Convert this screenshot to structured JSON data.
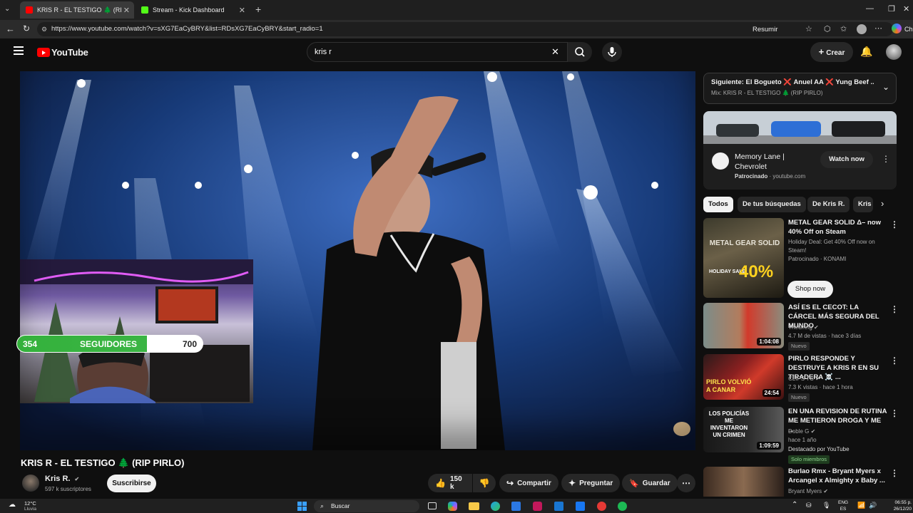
{
  "browser": {
    "tabs": [
      {
        "label": "KRIS R - EL TESTIGO 🌲 (RIP PIRLO",
        "favicon_color": "#ff0000"
      },
      {
        "label": "Stream - Kick Dashboard",
        "favicon_color": "#53fc18"
      }
    ],
    "url": "https://www.youtube.com/watch?v=sXG7EaCyBRY&list=RDsXG7EaCyBRY&start_radio=1",
    "resumir_label": "Resumir",
    "profile_partial": "Ch"
  },
  "youtube": {
    "logo_text": "YouTube",
    "search_value": "kris r",
    "create_label": "Crear"
  },
  "stream_overlay": {
    "followers_current": "354",
    "followers_label": "SEGUIDORES",
    "followers_goal": "700"
  },
  "video": {
    "title": "KRIS R - EL TESTIGO 🌲 (RIP PIRLO)",
    "channel": "Kris R.",
    "subscribers": "597 k suscriptores",
    "subscribe_label": "Suscribirse",
    "likes": "150 k",
    "share_label": "Compartir",
    "ask_label": "Preguntar",
    "save_label": "Guardar"
  },
  "up_next": {
    "title": "Siguiente: El Bogueto ❌ Anuel AA ❌ Yung Beef ...",
    "subtitle": "Mix: KRIS R - EL TESTIGO 🌲 (RIP PIRLO)"
  },
  "ad": {
    "title_line1": "Memory Lane |",
    "title_line2": "Chevrolet",
    "sponsored": "Patrocinado",
    "domain": "· youtube.com",
    "cta": "Watch now"
  },
  "chips": [
    "Todos",
    "De tus búsquedas",
    "De Kris R.",
    "Kris"
  ],
  "recommendations": [
    {
      "title": "METAL GEAR SOLID Δ– now 40% Off on Steam",
      "line1": "Holiday Deal: Get 40% Off now on Steam!",
      "line2": "Patrocinado · KONAMI",
      "cta": "Shop now",
      "thumb_text": "METAL GEAR SOLID",
      "thumb_sale": "40%",
      "thumb_sale_label": "HOLIDAY SALE"
    },
    {
      "title": "ASÍ ES EL CECOT: LA CÁRCEL MÁS SEGURA DEL MUNDO",
      "channel": "TheGrefg",
      "stats": "4.7 M de vistas · hace 3 días",
      "badge": "Nuevo",
      "duration": "1:04:08"
    },
    {
      "title": "PIRLO RESPONDE Y DESTRUYE A KRIS R EN SU TIRADERA ☠️ ...",
      "channel": "CLIPS TC",
      "stats": "7.3 K vistas · hace 1 hora",
      "badge": "Nuevo",
      "duration": "24:54",
      "thumb_text": "PIRLO VOLVIÓ A CANAR"
    },
    {
      "title": "EN UNA REVISION DE RUTINA ME METIERON DROGA Y ME ...",
      "channel": "Doble G",
      "stats": "hace 1 año",
      "extra": "Destacado por YouTube",
      "badge": "Solo miembros",
      "duration": "1:09:59",
      "thumb_text": "LOS POLICÍAS ME INVENTARON UN CRIMEN"
    },
    {
      "title": "Burlao Rmx - Bryant Myers x Arcangel x Almighty x Baby ...",
      "channel": "Bryant Myers"
    }
  ],
  "taskbar": {
    "weather_temp": "12°C",
    "weather_desc": "Lluvia",
    "search_label": "Buscar",
    "lang": "ENG",
    "region": "ES",
    "time": "06:55 p.",
    "date": "26/12/20"
  }
}
